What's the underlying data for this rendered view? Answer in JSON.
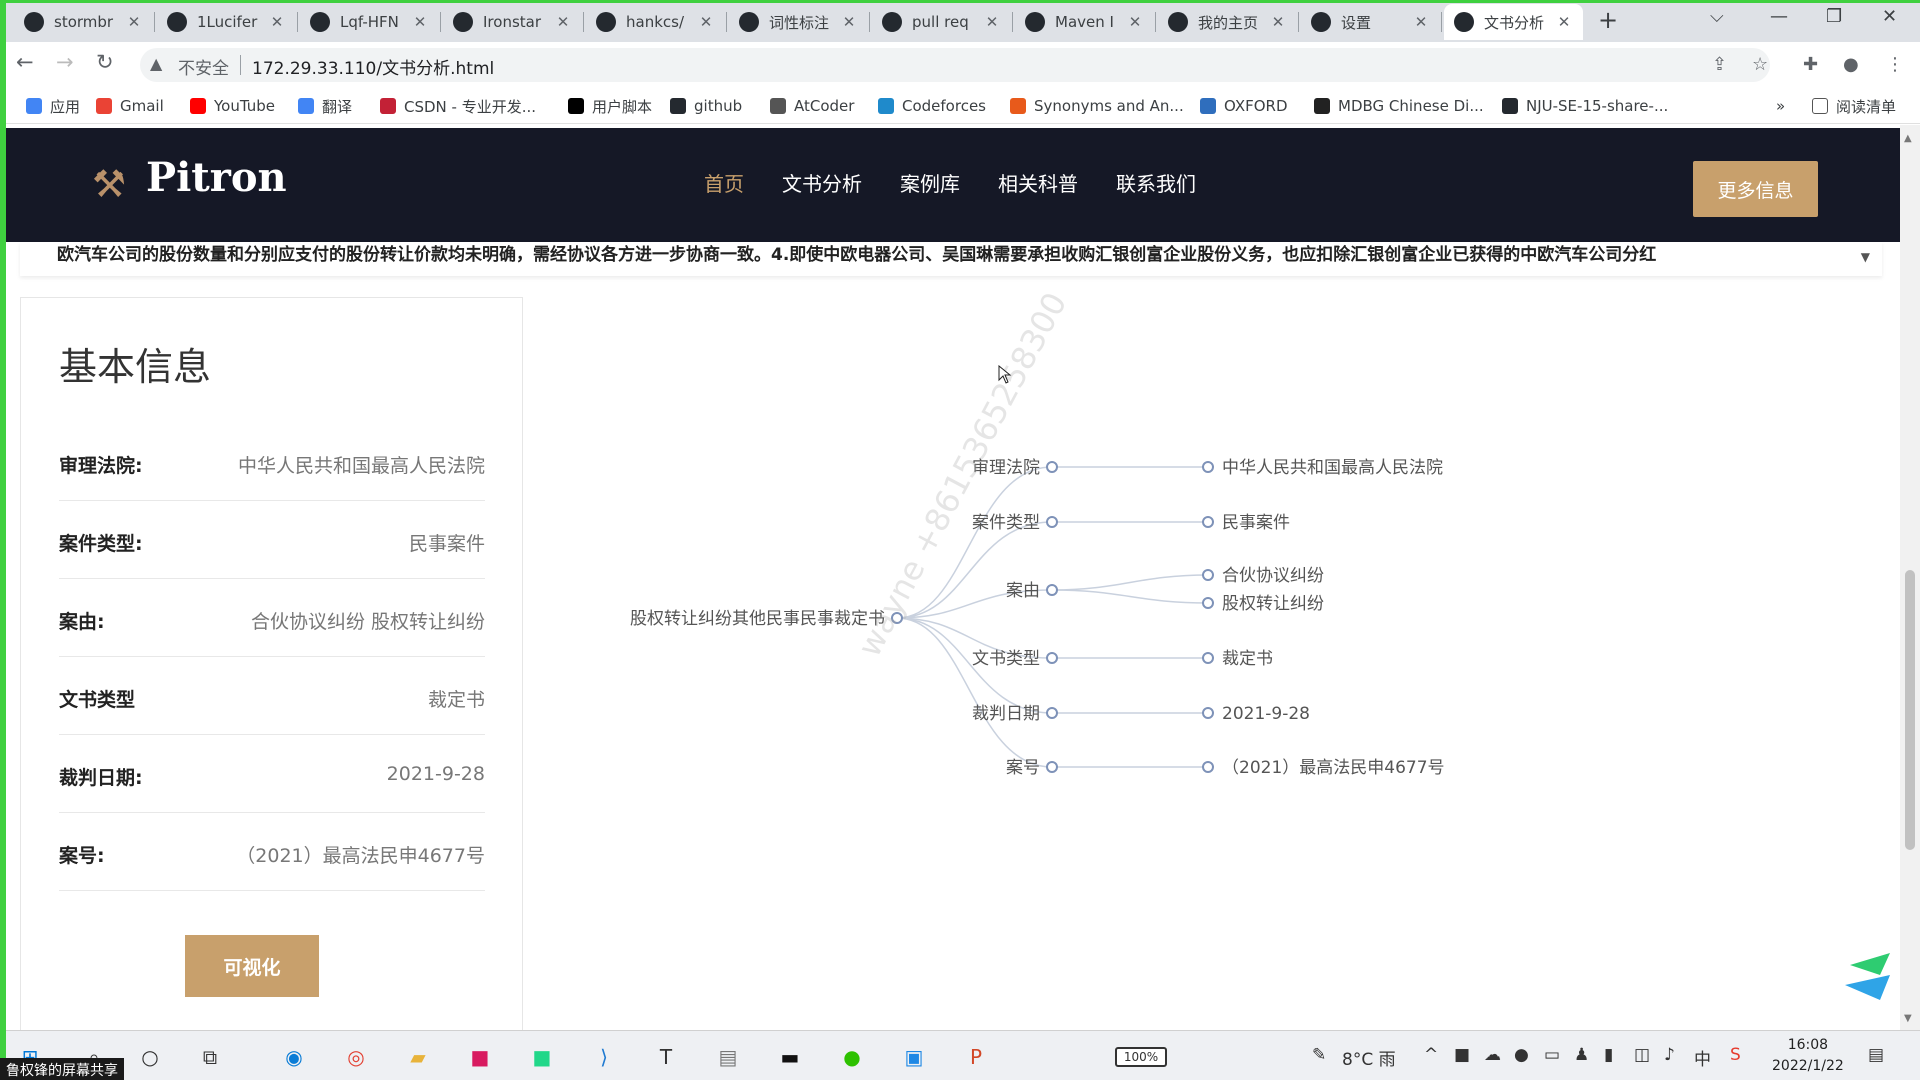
{
  "browser": {
    "tabs": [
      {
        "title": "stormbr",
        "icon": "github-icon"
      },
      {
        "title": "1Lucifer",
        "icon": "github-icon"
      },
      {
        "title": "Lqf-HFN",
        "icon": "github-icon"
      },
      {
        "title": "Ironstar",
        "icon": "github-icon"
      },
      {
        "title": "hankcs/",
        "icon": "github-icon"
      },
      {
        "title": "词性标注",
        "icon": "hanlp-icon"
      },
      {
        "title": "pull req",
        "icon": "gitee-icon"
      },
      {
        "title": "Maven I",
        "icon": "maven-icon"
      },
      {
        "title": "我的主页",
        "icon": "home-icon"
      },
      {
        "title": "设置",
        "icon": "gear-icon"
      },
      {
        "title": "文书分析",
        "icon": "globe-icon",
        "active": true
      }
    ],
    "security_label": "不安全",
    "url": "172.29.33.110/文书分析.html",
    "bookmarks": [
      {
        "label": "应用",
        "icon": "apps-grid-icon",
        "color": "#4285f4"
      },
      {
        "label": "Gmail",
        "icon": "gmail-icon",
        "color": "#ea4335"
      },
      {
        "label": "YouTube",
        "icon": "youtube-icon",
        "color": "#ff0000"
      },
      {
        "label": "翻译",
        "icon": "translate-icon",
        "color": "#4285f4"
      },
      {
        "label": "CSDN - 专业开发...",
        "icon": "csdn-icon",
        "color": "#c32136"
      },
      {
        "label": "用户脚本",
        "icon": "userscript-icon",
        "color": "#000000"
      },
      {
        "label": "github",
        "icon": "github-icon",
        "color": "#24292f"
      },
      {
        "label": "AtCoder",
        "icon": "atcoder-icon",
        "color": "#555555"
      },
      {
        "label": "Codeforces",
        "icon": "codeforces-icon",
        "color": "#1f8acb"
      },
      {
        "label": "Synonyms and An...",
        "icon": "thesaurus-icon",
        "color": "#e85a1b"
      },
      {
        "label": "OXFORD",
        "icon": "oxford-icon",
        "color": "#2f6ebd"
      },
      {
        "label": "MDBG Chinese Di...",
        "icon": "mdbg-icon",
        "color": "#222222"
      },
      {
        "label": "NJU-SE-15-share-...",
        "icon": "github-icon",
        "color": "#24292f"
      }
    ],
    "reading_list": "阅读清单"
  },
  "site": {
    "logo": "Pitron",
    "nav": [
      "首页",
      "文书分析",
      "案例库",
      "相关科普",
      "联系我们"
    ],
    "more_button": "更多信息"
  },
  "fulltext_snippet": "欧汽车公司的股份数量和分别应支付的股份转让价款均未明确，需经协议各方进一步协商一致。4.即使中欧电器公司、吴国琳需要承担收购汇银创富企业股份义务，也应扣除汇银创富企业已获得的中欧汽车公司分红",
  "basic_info": {
    "title": "基本信息",
    "rows": [
      {
        "label": "审理法院:",
        "value": "中华人民共和国最高人民法院"
      },
      {
        "label": "案件类型:",
        "value": "民事案件"
      },
      {
        "label": "案由:",
        "value": "合伙协议纠纷 股权转让纠纷"
      },
      {
        "label": "文书类型",
        "value": "裁定书"
      },
      {
        "label": "裁判日期:",
        "value": "2021-9-28"
      },
      {
        "label": "案号:",
        "value": "（2021）最高法民申4677号"
      }
    ],
    "visualize_button": "可视化"
  },
  "graph": {
    "root": "股权转让纠纷其他民事民事裁定书",
    "branches": [
      {
        "key": "审理法院",
        "values": [
          "中华人民共和国最高人民法院"
        ]
      },
      {
        "key": "案件类型",
        "values": [
          "民事案件"
        ]
      },
      {
        "key": "案由",
        "values": [
          "合伙协议纠纷",
          "股权转让纠纷"
        ]
      },
      {
        "key": "文书类型",
        "values": [
          "裁定书"
        ]
      },
      {
        "key": "裁判日期",
        "values": [
          "2021-9-28"
        ]
      },
      {
        "key": "案号",
        "values": [
          "（2021）最高法民申4677号"
        ]
      }
    ],
    "node_color": "#7e92b8",
    "link_color": "#c9d1de"
  },
  "watermark": "wayne +8615365258300",
  "taskbar": {
    "share_label": "鲁权锋的屏幕共享",
    "battery": "100%",
    "weather": "8°C 雨",
    "time": "16:08",
    "date": "2022/1/22"
  },
  "colors": {
    "accent": "#c8a06c",
    "header_bg": "#151826",
    "share_border": "#3fd03f"
  }
}
